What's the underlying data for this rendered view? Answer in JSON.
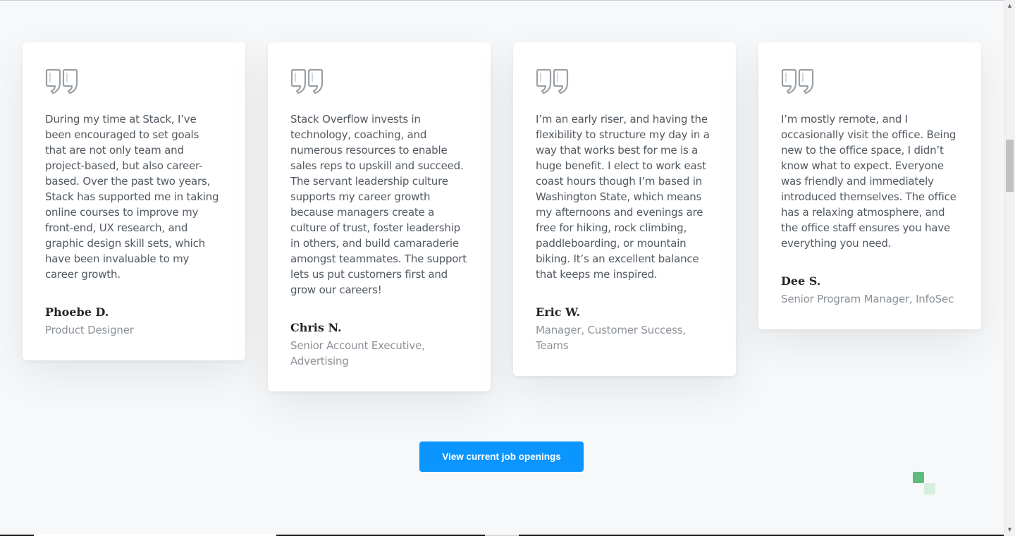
{
  "testimonials": [
    {
      "text": "During my time at Stack, I’ve been encouraged to set goals that are not only team and project-based, but also career-based. Over the past two years, Stack has supported me in taking online courses to improve my front-end, UX research, and graphic design skill sets, which have been invaluable to my career growth.",
      "name": "Phoebe D.",
      "role": "Product Designer"
    },
    {
      "text": "Stack Overflow invests in technology, coaching, and numerous resources to enable sales reps to upskill and succeed. The servant leadership culture supports my career growth because managers create a culture of trust, foster leadership in others, and build camaraderie amongst teammates. The support lets us put customers first and grow our careers!",
      "name": "Chris N.",
      "role": "Senior Account Executive, Advertising"
    },
    {
      "text": "I’m an early riser, and having the flexibility to structure my day in a way that works best for me is a huge benefit. I elect to work east coast hours though I’m based in Washington State, which means my afternoons and evenings are free for hiking, rock climbing, paddleboarding, or mountain biking. It’s an excellent balance that keeps me inspired.",
      "name": "Eric W.",
      "role": "Manager, Customer Success, Teams"
    },
    {
      "text": "I’m mostly remote, and I occasionally visit the office. Being new to the office space, I didn’t know what to expect. Everyone was friendly and immediately introduced themselves. The office has a relaxing atmosphere, and the office staff ensures you have everything you need.",
      "name": "Dee S.",
      "role": "Senior Program Manager, InfoSec"
    }
  ],
  "cta": {
    "label": "View current job openings"
  },
  "icons": {
    "quote": "quote-icon",
    "decoration": "squares-decoration"
  },
  "colors": {
    "accent": "#0a95ff",
    "deco_green": "#5eba7d",
    "deco_light": "#d6eedd"
  }
}
